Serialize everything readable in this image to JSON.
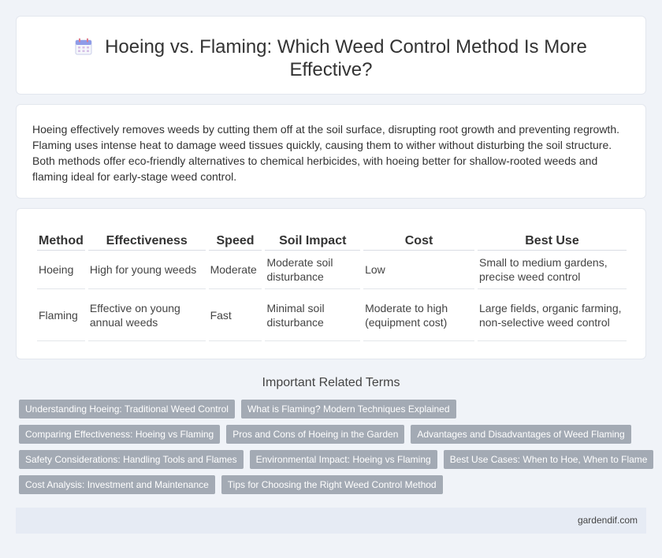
{
  "header": {
    "title": "Hoeing vs. Flaming: Which Weed Control Method Is More Effective?",
    "icon": "calendar-icon"
  },
  "intro": {
    "text": "Hoeing effectively removes weeds by cutting them off at the soil surface, disrupting root growth and preventing regrowth. Flaming uses intense heat to damage weed tissues quickly, causing them to wither without disturbing the soil structure. Both methods offer eco-friendly alternatives to chemical herbicides, with hoeing better for shallow-rooted weeds and flaming ideal for early-stage weed control."
  },
  "table": {
    "headers": [
      "Method",
      "Effectiveness",
      "Speed",
      "Soil Impact",
      "Cost",
      "Best Use"
    ],
    "rows": [
      [
        "Hoeing",
        "High for young weeds",
        "Moderate",
        "Moderate soil disturbance",
        "Low",
        "Small to medium gardens, precise weed control"
      ],
      [
        "Flaming",
        "Effective on young annual weeds",
        "Fast",
        "Minimal soil disturbance",
        "Moderate to high (equipment cost)",
        "Large fields, organic farming, non-selective weed control"
      ]
    ]
  },
  "related": {
    "title": "Important Related Terms",
    "tags": [
      "Understanding Hoeing: Traditional Weed Control",
      "What is Flaming? Modern Techniques Explained",
      "Comparing Effectiveness: Hoeing vs Flaming",
      "Pros and Cons of Hoeing in the Garden",
      "Advantages and Disadvantages of Weed Flaming",
      "Safety Considerations: Handling Tools and Flames",
      "Environmental Impact: Hoeing vs Flaming",
      "Best Use Cases: When to Hoe, When to Flame",
      "Cost Analysis: Investment and Maintenance",
      "Tips for Choosing the Right Weed Control Method"
    ]
  },
  "footer": {
    "site": "gardendif.com"
  },
  "colors": {
    "page_bg": "#f0f3f8",
    "tag_bg": "#a3aab4",
    "footer_bg": "#e6ebf4"
  }
}
